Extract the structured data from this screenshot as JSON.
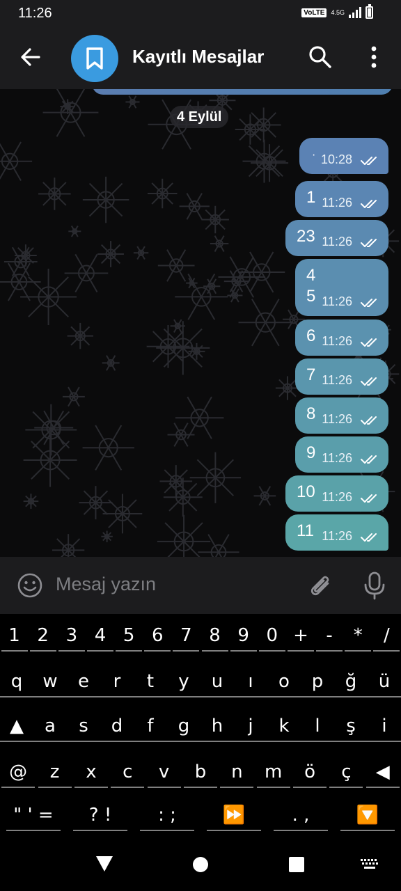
{
  "status_bar": {
    "time": "11:26",
    "volte": "VoLTE",
    "network": "4.5G"
  },
  "header": {
    "title": "Kayıtlı Mesajlar"
  },
  "chat": {
    "date_chip": "4 Eylül",
    "messages": [
      {
        "text": "·",
        "time": "10:28"
      },
      {
        "text": "1",
        "time": "11:26"
      },
      {
        "text": "23",
        "time": "11:26"
      },
      {
        "text": "4\n5",
        "time": "11:26"
      },
      {
        "text": "6",
        "time": "11:26"
      },
      {
        "text": "7",
        "time": "11:26"
      },
      {
        "text": "8",
        "time": "11:26"
      },
      {
        "text": "9",
        "time": "11:26"
      },
      {
        "text": "10",
        "time": "11:26"
      },
      {
        "text": "11",
        "time": "11:26"
      }
    ]
  },
  "input": {
    "placeholder": "Mesaj yazın"
  },
  "keyboard": {
    "row1": [
      "1",
      "2",
      "3",
      "4",
      "5",
      "6",
      "7",
      "8",
      "9",
      "0",
      "+",
      "-",
      "*",
      "/"
    ],
    "row2": [
      "q",
      "w",
      "e",
      "r",
      "t",
      "y",
      "u",
      "ı",
      "o",
      "p",
      "ğ",
      "ü"
    ],
    "row3": [
      "▲",
      "a",
      "s",
      "d",
      "f",
      "g",
      "h",
      "j",
      "k",
      "l",
      "ş",
      "i"
    ],
    "row4": [
      "@",
      "z",
      "x",
      "c",
      "v",
      "b",
      "n",
      "m",
      "ö",
      "ç",
      "◀"
    ],
    "row5": [
      "\" ' =",
      "? !",
      ": ;",
      "⏩",
      ". ,",
      "🔽"
    ]
  },
  "colors": {
    "bubble_top": "#5b82b4",
    "bubble_bottom": "#5aa6a8",
    "accent": "#3a9be0"
  }
}
